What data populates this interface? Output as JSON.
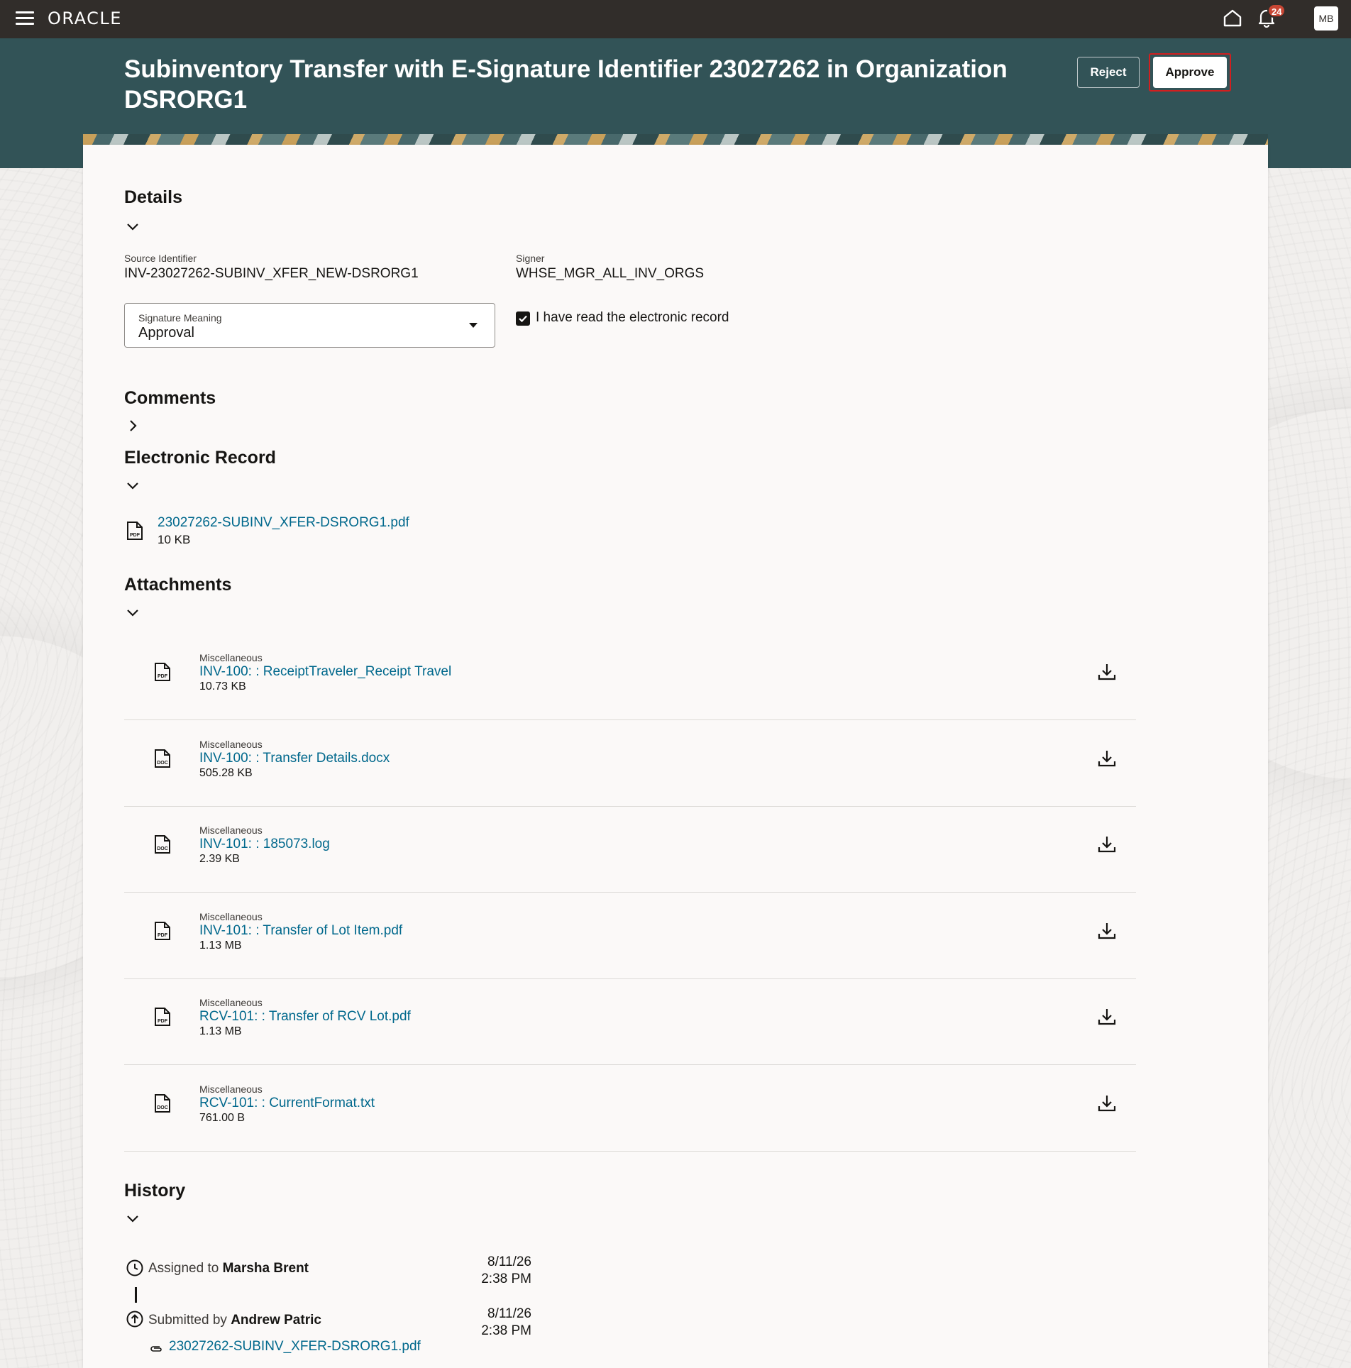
{
  "topbar": {
    "brand": "ORACLE",
    "notification_count": "24",
    "avatar_initials": "MB"
  },
  "header": {
    "title": "Subinventory Transfer with E-Signature Identifier 23027262 in Organization DSRORG1",
    "reject_label": "Reject",
    "approve_label": "Approve"
  },
  "details": {
    "title": "Details",
    "source_identifier_label": "Source Identifier",
    "source_identifier_value": "INV-23027262-SUBINV_XFER_NEW-DSRORG1",
    "signer_label": "Signer",
    "signer_value": "WHSE_MGR_ALL_INV_ORGS",
    "signature_meaning_label": "Signature Meaning",
    "signature_meaning_value": "Approval",
    "read_checkbox_label": "I have read the electronic record",
    "read_checkbox_checked": true
  },
  "comments": {
    "title": "Comments"
  },
  "electronic_record": {
    "title": "Electronic Record",
    "file_name": "23027262-SUBINV_XFER-DSRORG1.pdf",
    "file_size": "10 KB"
  },
  "attachments": {
    "title": "Attachments",
    "items": [
      {
        "category": "Miscellaneous",
        "name": "INV-100: : ReceiptTraveler_Receipt Travel",
        "size": "10.73 KB",
        "type": "PDF"
      },
      {
        "category": "Miscellaneous",
        "name": "INV-100: : Transfer Details.docx",
        "size": "505.28 KB",
        "type": "DOC"
      },
      {
        "category": "Miscellaneous",
        "name": "INV-101: : 185073.log",
        "size": "2.39 KB",
        "type": "DOC"
      },
      {
        "category": "Miscellaneous",
        "name": "INV-101: : Transfer of Lot Item.pdf",
        "size": "1.13 MB",
        "type": "PDF"
      },
      {
        "category": "Miscellaneous",
        "name": "RCV-101: : Transfer of RCV Lot.pdf",
        "size": "1.13 MB",
        "type": "PDF"
      },
      {
        "category": "Miscellaneous",
        "name": "RCV-101: : CurrentFormat.txt",
        "size": "761.00 B",
        "type": "DOC"
      }
    ]
  },
  "history": {
    "title": "History",
    "entries": [
      {
        "action": "Assigned to",
        "person": "Marsha Brent",
        "date": "8/11/26",
        "time": "2:38 PM"
      },
      {
        "action": "Submitted by",
        "person": "Andrew Patric",
        "date": "8/11/26",
        "time": "2:38 PM",
        "attachment": "23027262-SUBINV_XFER-DSRORG1.pdf"
      }
    ]
  },
  "colors": {
    "topbar": "#312d2a",
    "header_band": "#325357",
    "link": "#00688c",
    "badge": "#c74634",
    "highlight_border": "#d21f1f"
  }
}
